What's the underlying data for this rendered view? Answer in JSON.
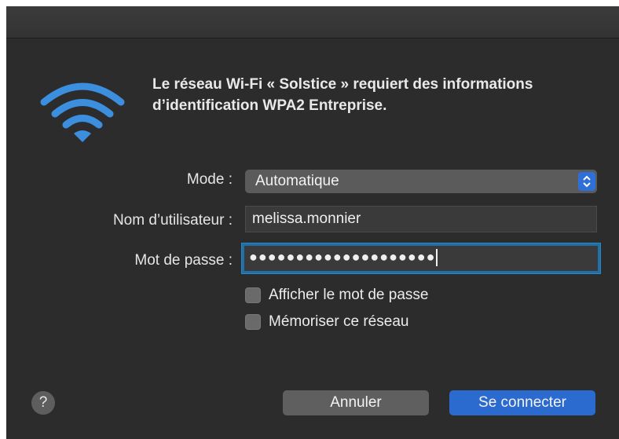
{
  "dialog": {
    "message": "Le réseau Wi-Fi « Solstice » requiert des informations d’identification WPA2 Entreprise.",
    "icon": "wifi-icon"
  },
  "form": {
    "mode_label": "Mode :",
    "mode_value": "Automatique",
    "username_label": "Nom d’utilisateur :",
    "username_value": "melissa.monnier",
    "password_label": "Mot de passe :",
    "password_masked": "●●●●●●●●●●●●●●●●●●●●",
    "show_password_label": "Afficher le mot de passe",
    "remember_network_label": "Mémoriser ce réseau"
  },
  "buttons": {
    "help_label": "?",
    "cancel_label": "Annuler",
    "connect_label": "Se connecter"
  },
  "colors": {
    "accent": "#2b6bd0",
    "background": "#2c2c2c",
    "wifi_icon": "#3c8fde"
  }
}
